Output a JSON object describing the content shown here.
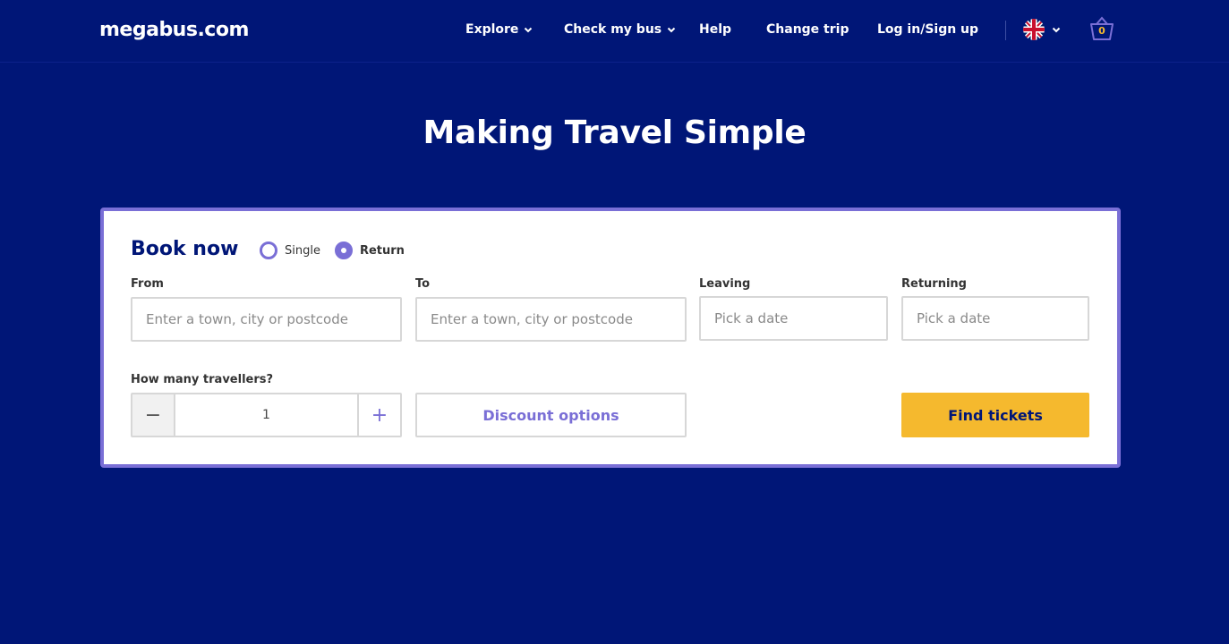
{
  "header": {
    "logo": "megabus.com",
    "nav": [
      {
        "label": "Explore",
        "dropdown": true
      },
      {
        "label": "Check my bus",
        "dropdown": true
      },
      {
        "label": "Help",
        "dropdown": false
      },
      {
        "label": "Change trip",
        "dropdown": false
      },
      {
        "label": "Log in/Sign up",
        "dropdown": false
      }
    ],
    "language_icon": "uk-flag-icon",
    "basket_count": "0"
  },
  "hero": {
    "title": "Making Travel Simple"
  },
  "booking": {
    "title": "Book now",
    "trip_types": [
      {
        "label": "Single",
        "selected": false
      },
      {
        "label": "Return",
        "selected": true
      }
    ],
    "from": {
      "label": "From",
      "placeholder": "Enter a town, city or postcode",
      "value": ""
    },
    "to": {
      "label": "To",
      "placeholder": "Enter a town, city or postcode",
      "value": ""
    },
    "leaving": {
      "label": "Leaving",
      "placeholder": "Pick a date",
      "value": ""
    },
    "returning": {
      "label": "Returning",
      "placeholder": "Pick a date",
      "value": ""
    },
    "travellers": {
      "label": "How many travellers?",
      "value": "1",
      "minus": "−",
      "plus": "+"
    },
    "discount_label": "Discount options",
    "find_label": "Find tickets"
  },
  "colors": {
    "background": "#001677",
    "accent": "#7a6fd6",
    "cta": "#f5b92e"
  }
}
